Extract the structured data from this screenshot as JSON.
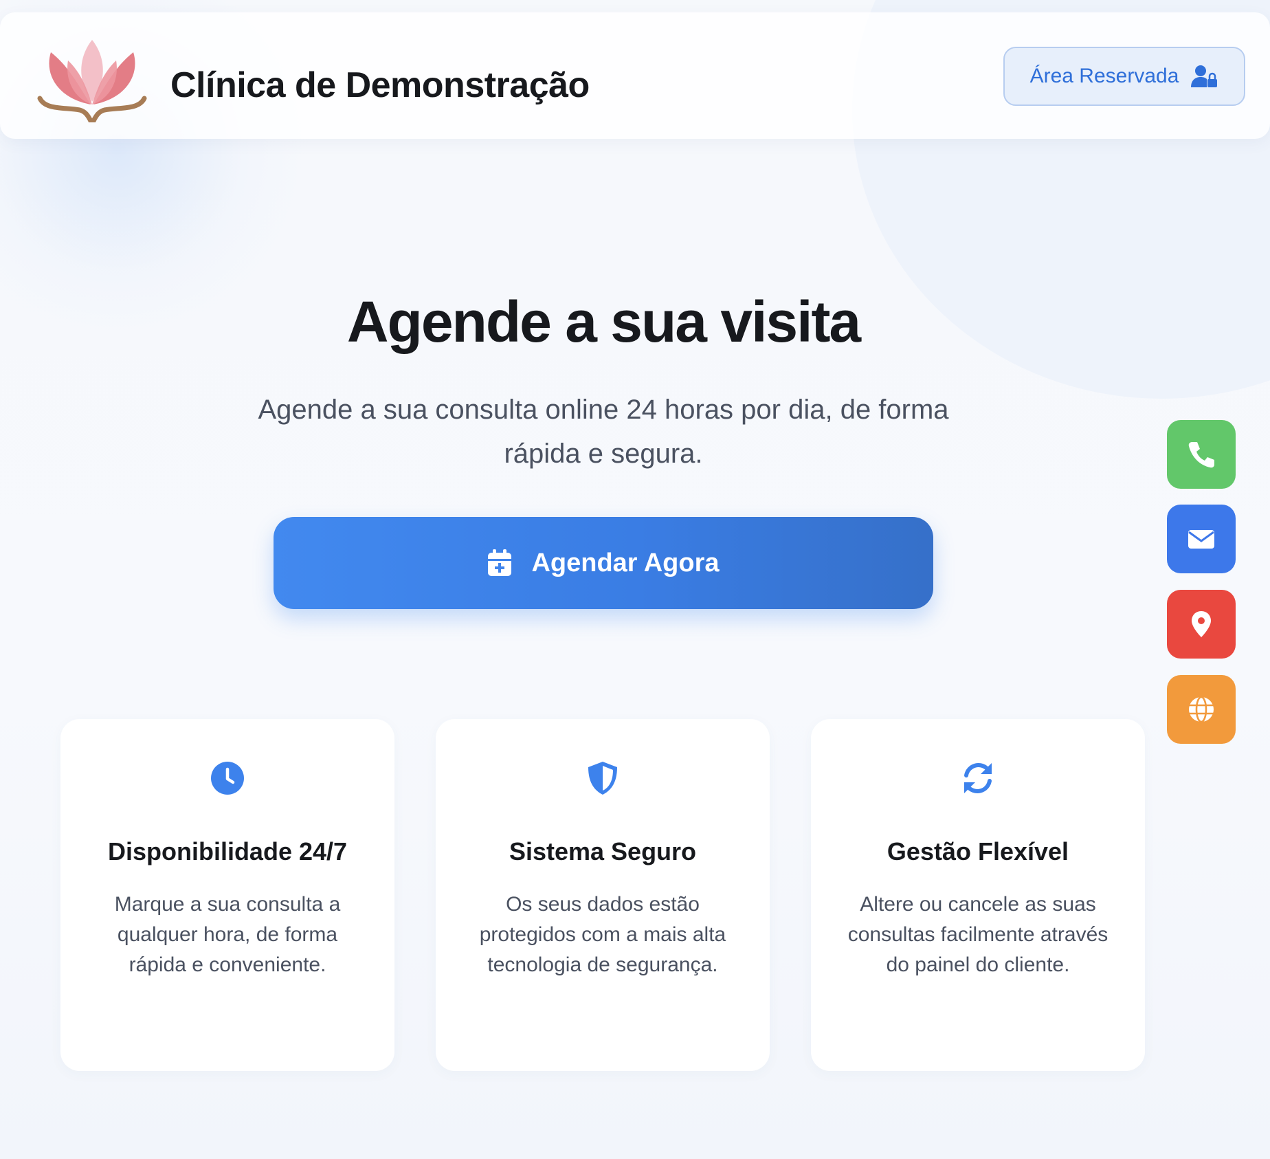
{
  "header": {
    "brand": "Clínica de Demonstração",
    "logo": "lotus-logo",
    "reserved_label": "Área Reservada",
    "reserved_icon": "user-lock-icon"
  },
  "hero": {
    "title": "Agende a sua visita",
    "subtitle": "Agende a sua consulta online 24 horas por dia, de forma rápida e segura.",
    "cta_label": "Agendar Agora",
    "cta_icon": "calendar-plus-icon"
  },
  "contacts": [
    {
      "icon": "phone-icon",
      "color": "#62c76a"
    },
    {
      "icon": "envelope-icon",
      "color": "#3d78ea"
    },
    {
      "icon": "map-pin-icon",
      "color": "#e9483f"
    },
    {
      "icon": "globe-icon",
      "color": "#f29a3c"
    }
  ],
  "features": [
    {
      "icon": "clock-icon",
      "title": "Disponibilidade 24/7",
      "text": "Marque a sua consulta a qualquer hora, de forma rápida e conveniente."
    },
    {
      "icon": "shield-icon",
      "title": "Sistema Seguro",
      "text": "Os seus dados estão protegidos com a mais alta tecnologia de segurança."
    },
    {
      "icon": "refresh-icon",
      "title": "Gestão Flexível",
      "text": "Altere ou cancele as suas consultas facilmente através do painel do cliente."
    }
  ],
  "colors": {
    "accent": "#3a7de4",
    "text": "#17191d",
    "muted": "#4a5160"
  }
}
